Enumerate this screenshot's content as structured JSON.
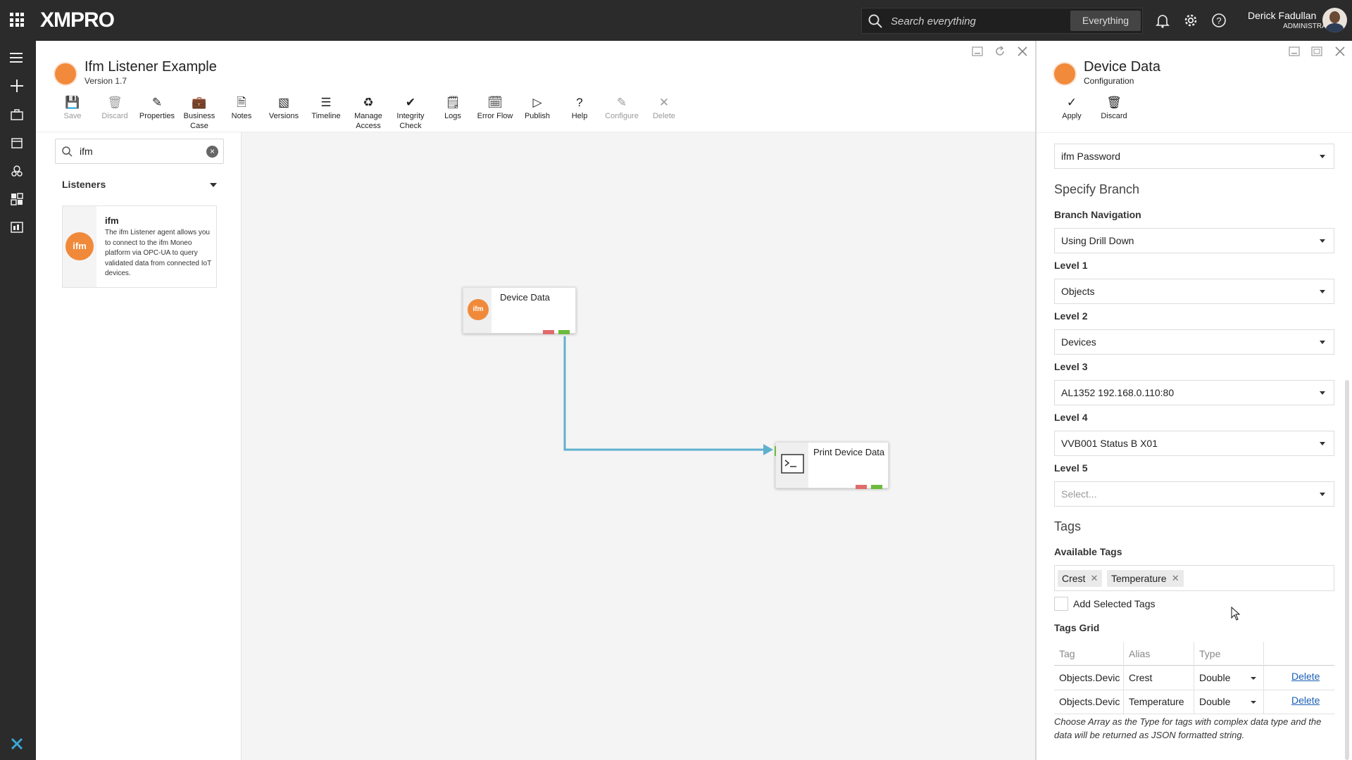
{
  "topbar": {
    "brand": "XMPRO",
    "search_placeholder": "Search everything",
    "scope": "Everything",
    "user_name": "Derick Fadullan",
    "user_role": "ADMINISTRATOR"
  },
  "stream": {
    "title": "Ifm Listener Example",
    "version": "Version 1.7",
    "toolbar": [
      {
        "label": "Save",
        "icon": "save-icon",
        "disabled": true
      },
      {
        "label": "Discard",
        "icon": "trash-icon",
        "disabled": true
      },
      {
        "label": "Properties",
        "icon": "pencil-icon",
        "disabled": false
      },
      {
        "label": "Business Case",
        "icon": "briefcase-icon",
        "disabled": false
      },
      {
        "label": "Notes",
        "icon": "notes-icon",
        "disabled": false
      },
      {
        "label": "Versions",
        "icon": "versions-icon",
        "disabled": false
      },
      {
        "label": "Timeline",
        "icon": "timeline-icon",
        "disabled": false
      },
      {
        "label": "Manage Access",
        "icon": "recycle-icon",
        "disabled": false
      },
      {
        "label": "Integrity Check",
        "icon": "check-circle-icon",
        "disabled": false
      },
      {
        "label": "Logs",
        "icon": "logs-icon",
        "disabled": false
      },
      {
        "label": "Error Flow",
        "icon": "error-flow-icon",
        "disabled": false
      },
      {
        "label": "Publish",
        "icon": "play-icon",
        "disabled": false
      },
      {
        "label": "Help",
        "icon": "help-icon",
        "disabled": false
      },
      {
        "label": "Configure",
        "icon": "pencil-icon",
        "disabled": true
      },
      {
        "label": "Delete",
        "icon": "close-icon",
        "disabled": true
      }
    ]
  },
  "library": {
    "search_value": "ifm",
    "group_title": "Listeners",
    "agent_name": "ifm",
    "agent_desc": "The ifm Listener agent allows you to connect to the ifm Moneo platform via OPC-UA to query validated data from connected IoT devices."
  },
  "canvas": {
    "nodes": [
      {
        "label": "Device Data"
      },
      {
        "label": "Print Device Data"
      }
    ]
  },
  "panel": {
    "title": "Device Data",
    "subtitle": "Configuration",
    "apply_label": "Apply",
    "discard_label": "Discard",
    "password_value": "ifm Password",
    "specify_branch": "Specify Branch",
    "branch_nav_label": "Branch Navigation",
    "branch_nav_value": "Using Drill Down",
    "levels": [
      {
        "label": "Level 1",
        "value": "Objects"
      },
      {
        "label": "Level 2",
        "value": "Devices"
      },
      {
        "label": "Level 3",
        "value": "AL1352 192.168.0.110:80"
      },
      {
        "label": "Level 4",
        "value": "VVB001 Status B X01"
      },
      {
        "label": "Level 5",
        "value": "Select..."
      }
    ],
    "tags_title": "Tags",
    "available_tags_label": "Available Tags",
    "available_tags": [
      "Crest",
      "Temperature"
    ],
    "add_selected_label": "Add Selected Tags",
    "tags_grid_label": "Tags Grid",
    "grid_headers": [
      "Tag",
      "Alias",
      "Type"
    ],
    "grid_rows": [
      {
        "tag": "Objects.Devic",
        "alias": "Crest",
        "type": "Double",
        "action": "Delete"
      },
      {
        "tag": "Objects.Devic",
        "alias": "Temperature",
        "type": "Double",
        "action": "Delete"
      }
    ],
    "hint": "Choose Array as the Type for tags with complex data type and the data will be returned as JSON formatted string."
  }
}
